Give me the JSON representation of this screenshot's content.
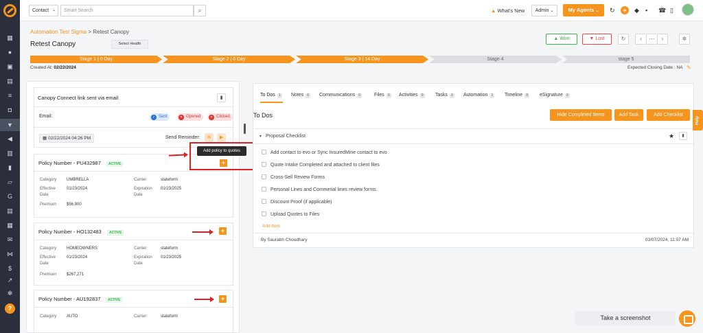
{
  "topbar": {
    "entity_select": "Contact",
    "search_placeholder": "Smart Search",
    "whats_new": "What's New",
    "admin": "Admin",
    "my_agents": "My Agents"
  },
  "breadcrumb": {
    "root": "Automation Test Sigma",
    "sep": " > ",
    "current": "Retest Canopy"
  },
  "page": {
    "title": "Retest Canopy",
    "health": "Select Health",
    "won": "Won",
    "lost": "Lost",
    "created_label": "Created At:",
    "created_value": "02/22/2024",
    "closing": "Expected Closing Date : NA"
  },
  "stages": [
    {
      "label": "Stage 1 | 0 Day"
    },
    {
      "label": "Stage 2 | 0 Day"
    },
    {
      "label": "Stage 3 | 14 Day"
    },
    {
      "label": "Stage 4"
    },
    {
      "label": "stage 5"
    }
  ],
  "canopy": {
    "title": "Canopy Connect link sent via email",
    "email_label": "Email:",
    "sent": "Sent",
    "opened": "Opened",
    "clicked": "Clicked",
    "date": "02/22/2024 04:26 PM",
    "reminder_label": "Send Reminder:"
  },
  "tooltip": "Add policy to quotes",
  "policies": [
    {
      "title": "Policy Number - PU432987",
      "status": "ACTIVE",
      "category_label": "Category",
      "category": "UMBRELLA",
      "carrier_label": "Carrier",
      "carrier": "stateform",
      "eff_label": "Effective",
      "eff_label2": "Date",
      "eff": "01/23/2024",
      "exp_label": "Expiration",
      "exp_label2": "Date",
      "exp": "01/23/2025",
      "premium_label": "Premium",
      "premium": "$56,900"
    },
    {
      "title": "Policy Number - HO132483",
      "status": "ACTIVE",
      "category_label": "Category",
      "category": "HOMEOWNERS",
      "carrier_label": "Carrier",
      "carrier": "stateform",
      "eff_label": "Effective",
      "eff_label2": "Date",
      "eff": "01/23/2024",
      "exp_label": "Expiration",
      "exp_label2": "Date",
      "exp": "01/23/2025",
      "premium_label": "Premium",
      "premium": "$267,271"
    },
    {
      "title": "Policy Number - AU192837",
      "status": "ACTIVE",
      "category_label": "Category",
      "category": "AUTO",
      "carrier_label": "Carrier",
      "carrier": "stateform"
    }
  ],
  "tabs": [
    {
      "label": "To Dos",
      "count": "1"
    },
    {
      "label": "Notes",
      "count": "0"
    },
    {
      "label": "Communications",
      "count": "0"
    },
    {
      "label": "Files",
      "count": "0"
    },
    {
      "label": "Activities",
      "count": "0"
    },
    {
      "label": "Tasks",
      "count": "0"
    },
    {
      "label": "Automation",
      "count": "1"
    },
    {
      "label": "Timeline",
      "count": "0"
    },
    {
      "label": "eSignature",
      "count": "0"
    }
  ],
  "todos": {
    "heading": "To Dos",
    "hide_completed": "Hide Completed Items",
    "add_task": "Add Task",
    "add_checklist": "Add Checklist",
    "checklist_title": "Proposal Checklist",
    "items": [
      "Add contact to evo or Sync InsuredMine contact to evo",
      "Quote Intake Completed and attached to client files",
      "Cross-Sell Review Forms",
      "Personal Lines and Commerial lines review forms.",
      "Discount Proof (if applicable)",
      "Upload Quotes to Files"
    ],
    "add_item": "Add Item",
    "by": "By Saurabh Choudhary",
    "date": "03/07/2024, 11:07 AM"
  },
  "help_tab": "Help",
  "screenshot_button": "Take a screenshot",
  "colors": {
    "accent": "#f7941d",
    "sidebar": "#2a2f3b",
    "won": "#3ab54a",
    "lost": "#e34b4b",
    "annotation": "#e32020"
  }
}
